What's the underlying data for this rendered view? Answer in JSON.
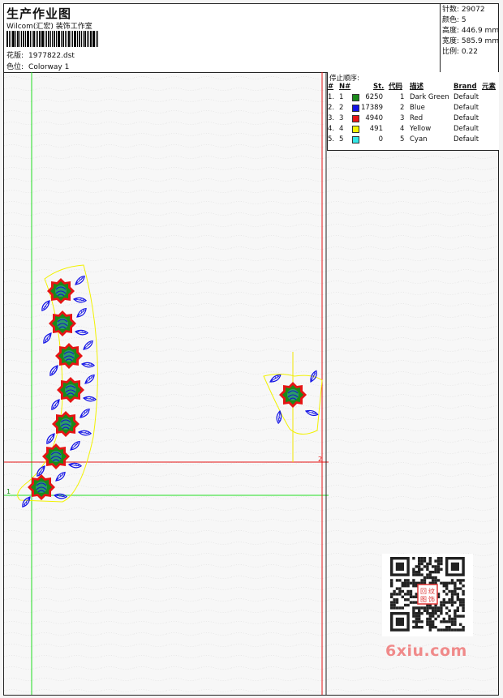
{
  "header": {
    "title": "生产作业图",
    "company": "Wilcom(汇宏) 装饰工作室",
    "design_label": "花版:",
    "design_value": "1977822.dst",
    "color_label": "色位:",
    "color_value": "Colorway 1"
  },
  "specs": {
    "stitches_label": "针数:",
    "stitches_value": "29072",
    "colors_label": "颜色:",
    "colors_value": "5",
    "height_label": "高度:",
    "height_value": "446.9 mm",
    "width_label": "宽度:",
    "width_value": "585.9 mm",
    "ratio_label": "比例:",
    "ratio_value": "0.22"
  },
  "stop_sequence": {
    "title": "停止顺序:",
    "headers": {
      "num": "#",
      "n": "N#",
      "st": "St.",
      "code": "代码",
      "desc": "描述",
      "brand": "Brand",
      "element": "元素"
    },
    "rows": [
      {
        "num": "1.",
        "n": "1",
        "color": "#1a8a1a",
        "st": "6250",
        "code": "1",
        "desc": "Dark Green",
        "brand": "Default"
      },
      {
        "num": "2.",
        "n": "2",
        "color": "#1414e6",
        "st": "17389",
        "code": "2",
        "desc": "Blue",
        "brand": "Default"
      },
      {
        "num": "3.",
        "n": "3",
        "color": "#e61414",
        "st": "4940",
        "code": "3",
        "desc": "Red",
        "brand": "Default"
      },
      {
        "num": "4.",
        "n": "4",
        "color": "#f2f200",
        "st": "491",
        "code": "4",
        "desc": "Yellow",
        "brand": "Default"
      },
      {
        "num": "5.",
        "n": "5",
        "color": "#33e6e6",
        "st": "0",
        "code": "5",
        "desc": "Cyan",
        "brand": "Default"
      }
    ]
  },
  "markers": {
    "start": "1",
    "end": "2"
  },
  "watermark": "6xiu.com",
  "stamp_text": "回纹图饰"
}
